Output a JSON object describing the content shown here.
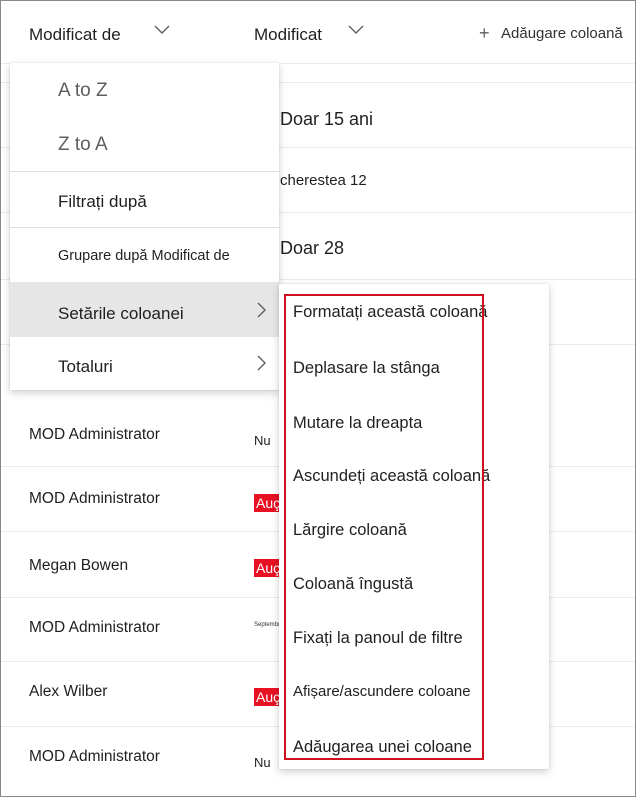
{
  "header": {
    "col1_label": "Modificat de",
    "col2_label": "Modificat",
    "add_column_label": "Adăugare coloană"
  },
  "rows": [
    {
      "modified_value": "Doar 15 ani"
    },
    {
      "modified_value": "cherestea 12"
    },
    {
      "modified_value": "Doar 28"
    },
    {
      "modified_by": "MOD Administrator",
      "modified_value": "Nu"
    },
    {
      "modified_by": "MOD Administrator",
      "modified_value": "Auç"
    },
    {
      "modified_by": "Megan Bowen",
      "modified_value": "Auç"
    },
    {
      "modified_by": "MOD Administrator",
      "modified_value": "Septembrie"
    },
    {
      "modified_by": "Alex Wilber",
      "modified_value": "Auç"
    },
    {
      "modified_by": "MOD Administrator",
      "modified_value": "Nu"
    }
  ],
  "column_menu": {
    "sort_az": "A to Z",
    "sort_za": "Z to A",
    "filter_by": "Filtrați după",
    "group_by": "Grupare după Modificat de",
    "column_settings": "Setările coloanei",
    "totals": "Totaluri"
  },
  "settings_submenu": {
    "items": [
      "Formatați această coloană",
      "Deplasare la stânga",
      "Mutare la dreapta",
      "Ascundeți această coloană",
      "Lărgire coloană",
      "Coloană îngustă",
      "Fixați la panoul de filtre",
      "Afișare/ascundere coloane",
      "Adăugarea unei coloane"
    ]
  },
  "colors": {
    "highlight_border": "#d0101c",
    "badge_red": "#e81123",
    "hover_bg": "#e6e6e6"
  }
}
